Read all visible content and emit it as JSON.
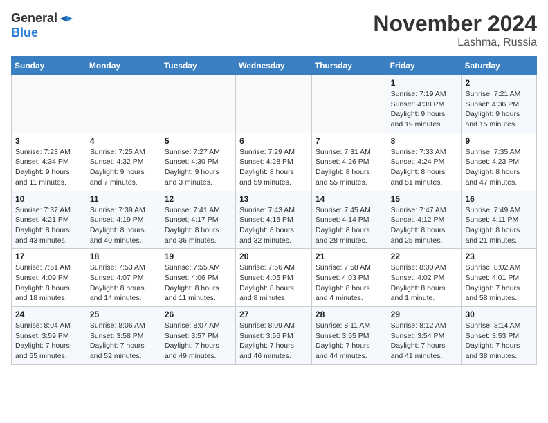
{
  "header": {
    "logo_general": "General",
    "logo_blue": "Blue",
    "main_title": "November 2024",
    "subtitle": "Lashma, Russia"
  },
  "weekdays": [
    "Sunday",
    "Monday",
    "Tuesday",
    "Wednesday",
    "Thursday",
    "Friday",
    "Saturday"
  ],
  "weeks": [
    {
      "days": [
        {
          "num": "",
          "info": ""
        },
        {
          "num": "",
          "info": ""
        },
        {
          "num": "",
          "info": ""
        },
        {
          "num": "",
          "info": ""
        },
        {
          "num": "",
          "info": ""
        },
        {
          "num": "1",
          "info": "Sunrise: 7:19 AM\nSunset: 4:38 PM\nDaylight: 9 hours\nand 19 minutes."
        },
        {
          "num": "2",
          "info": "Sunrise: 7:21 AM\nSunset: 4:36 PM\nDaylight: 9 hours\nand 15 minutes."
        }
      ]
    },
    {
      "days": [
        {
          "num": "3",
          "info": "Sunrise: 7:23 AM\nSunset: 4:34 PM\nDaylight: 9 hours\nand 11 minutes."
        },
        {
          "num": "4",
          "info": "Sunrise: 7:25 AM\nSunset: 4:32 PM\nDaylight: 9 hours\nand 7 minutes."
        },
        {
          "num": "5",
          "info": "Sunrise: 7:27 AM\nSunset: 4:30 PM\nDaylight: 9 hours\nand 3 minutes."
        },
        {
          "num": "6",
          "info": "Sunrise: 7:29 AM\nSunset: 4:28 PM\nDaylight: 8 hours\nand 59 minutes."
        },
        {
          "num": "7",
          "info": "Sunrise: 7:31 AM\nSunset: 4:26 PM\nDaylight: 8 hours\nand 55 minutes."
        },
        {
          "num": "8",
          "info": "Sunrise: 7:33 AM\nSunset: 4:24 PM\nDaylight: 8 hours\nand 51 minutes."
        },
        {
          "num": "9",
          "info": "Sunrise: 7:35 AM\nSunset: 4:23 PM\nDaylight: 8 hours\nand 47 minutes."
        }
      ]
    },
    {
      "days": [
        {
          "num": "10",
          "info": "Sunrise: 7:37 AM\nSunset: 4:21 PM\nDaylight: 8 hours\nand 43 minutes."
        },
        {
          "num": "11",
          "info": "Sunrise: 7:39 AM\nSunset: 4:19 PM\nDaylight: 8 hours\nand 40 minutes."
        },
        {
          "num": "12",
          "info": "Sunrise: 7:41 AM\nSunset: 4:17 PM\nDaylight: 8 hours\nand 36 minutes."
        },
        {
          "num": "13",
          "info": "Sunrise: 7:43 AM\nSunset: 4:15 PM\nDaylight: 8 hours\nand 32 minutes."
        },
        {
          "num": "14",
          "info": "Sunrise: 7:45 AM\nSunset: 4:14 PM\nDaylight: 8 hours\nand 28 minutes."
        },
        {
          "num": "15",
          "info": "Sunrise: 7:47 AM\nSunset: 4:12 PM\nDaylight: 8 hours\nand 25 minutes."
        },
        {
          "num": "16",
          "info": "Sunrise: 7:49 AM\nSunset: 4:11 PM\nDaylight: 8 hours\nand 21 minutes."
        }
      ]
    },
    {
      "days": [
        {
          "num": "17",
          "info": "Sunrise: 7:51 AM\nSunset: 4:09 PM\nDaylight: 8 hours\nand 18 minutes."
        },
        {
          "num": "18",
          "info": "Sunrise: 7:53 AM\nSunset: 4:07 PM\nDaylight: 8 hours\nand 14 minutes."
        },
        {
          "num": "19",
          "info": "Sunrise: 7:55 AM\nSunset: 4:06 PM\nDaylight: 8 hours\nand 11 minutes."
        },
        {
          "num": "20",
          "info": "Sunrise: 7:56 AM\nSunset: 4:05 PM\nDaylight: 8 hours\nand 8 minutes."
        },
        {
          "num": "21",
          "info": "Sunrise: 7:58 AM\nSunset: 4:03 PM\nDaylight: 8 hours\nand 4 minutes."
        },
        {
          "num": "22",
          "info": "Sunrise: 8:00 AM\nSunset: 4:02 PM\nDaylight: 8 hours\nand 1 minute."
        },
        {
          "num": "23",
          "info": "Sunrise: 8:02 AM\nSunset: 4:01 PM\nDaylight: 7 hours\nand 58 minutes."
        }
      ]
    },
    {
      "days": [
        {
          "num": "24",
          "info": "Sunrise: 8:04 AM\nSunset: 3:59 PM\nDaylight: 7 hours\nand 55 minutes."
        },
        {
          "num": "25",
          "info": "Sunrise: 8:06 AM\nSunset: 3:58 PM\nDaylight: 7 hours\nand 52 minutes."
        },
        {
          "num": "26",
          "info": "Sunrise: 8:07 AM\nSunset: 3:57 PM\nDaylight: 7 hours\nand 49 minutes."
        },
        {
          "num": "27",
          "info": "Sunrise: 8:09 AM\nSunset: 3:56 PM\nDaylight: 7 hours\nand 46 minutes."
        },
        {
          "num": "28",
          "info": "Sunrise: 8:11 AM\nSunset: 3:55 PM\nDaylight: 7 hours\nand 44 minutes."
        },
        {
          "num": "29",
          "info": "Sunrise: 8:12 AM\nSunset: 3:54 PM\nDaylight: 7 hours\nand 41 minutes."
        },
        {
          "num": "30",
          "info": "Sunrise: 8:14 AM\nSunset: 3:53 PM\nDaylight: 7 hours\nand 38 minutes."
        }
      ]
    }
  ]
}
